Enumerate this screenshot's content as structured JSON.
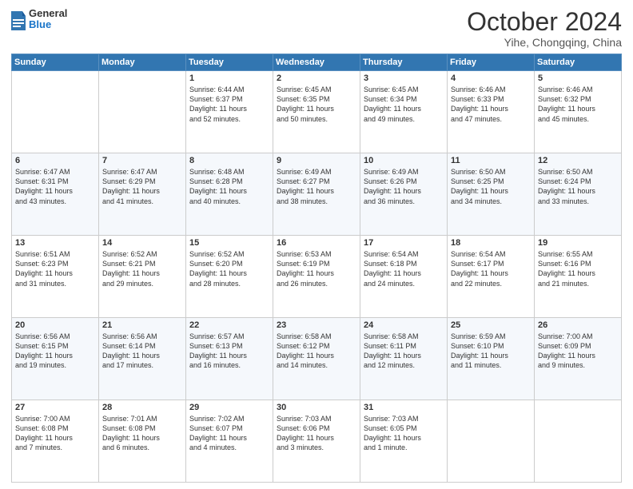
{
  "header": {
    "logo_general": "General",
    "logo_blue": "Blue",
    "month_title": "October 2024",
    "location": "Yihe, Chongqing, China"
  },
  "weekdays": [
    "Sunday",
    "Monday",
    "Tuesday",
    "Wednesday",
    "Thursday",
    "Friday",
    "Saturday"
  ],
  "rows": [
    [
      {
        "day": "",
        "text": ""
      },
      {
        "day": "",
        "text": ""
      },
      {
        "day": "1",
        "text": "Sunrise: 6:44 AM\nSunset: 6:37 PM\nDaylight: 11 hours\nand 52 minutes."
      },
      {
        "day": "2",
        "text": "Sunrise: 6:45 AM\nSunset: 6:35 PM\nDaylight: 11 hours\nand 50 minutes."
      },
      {
        "day": "3",
        "text": "Sunrise: 6:45 AM\nSunset: 6:34 PM\nDaylight: 11 hours\nand 49 minutes."
      },
      {
        "day": "4",
        "text": "Sunrise: 6:46 AM\nSunset: 6:33 PM\nDaylight: 11 hours\nand 47 minutes."
      },
      {
        "day": "5",
        "text": "Sunrise: 6:46 AM\nSunset: 6:32 PM\nDaylight: 11 hours\nand 45 minutes."
      }
    ],
    [
      {
        "day": "6",
        "text": "Sunrise: 6:47 AM\nSunset: 6:31 PM\nDaylight: 11 hours\nand 43 minutes."
      },
      {
        "day": "7",
        "text": "Sunrise: 6:47 AM\nSunset: 6:29 PM\nDaylight: 11 hours\nand 41 minutes."
      },
      {
        "day": "8",
        "text": "Sunrise: 6:48 AM\nSunset: 6:28 PM\nDaylight: 11 hours\nand 40 minutes."
      },
      {
        "day": "9",
        "text": "Sunrise: 6:49 AM\nSunset: 6:27 PM\nDaylight: 11 hours\nand 38 minutes."
      },
      {
        "day": "10",
        "text": "Sunrise: 6:49 AM\nSunset: 6:26 PM\nDaylight: 11 hours\nand 36 minutes."
      },
      {
        "day": "11",
        "text": "Sunrise: 6:50 AM\nSunset: 6:25 PM\nDaylight: 11 hours\nand 34 minutes."
      },
      {
        "day": "12",
        "text": "Sunrise: 6:50 AM\nSunset: 6:24 PM\nDaylight: 11 hours\nand 33 minutes."
      }
    ],
    [
      {
        "day": "13",
        "text": "Sunrise: 6:51 AM\nSunset: 6:23 PM\nDaylight: 11 hours\nand 31 minutes."
      },
      {
        "day": "14",
        "text": "Sunrise: 6:52 AM\nSunset: 6:21 PM\nDaylight: 11 hours\nand 29 minutes."
      },
      {
        "day": "15",
        "text": "Sunrise: 6:52 AM\nSunset: 6:20 PM\nDaylight: 11 hours\nand 28 minutes."
      },
      {
        "day": "16",
        "text": "Sunrise: 6:53 AM\nSunset: 6:19 PM\nDaylight: 11 hours\nand 26 minutes."
      },
      {
        "day": "17",
        "text": "Sunrise: 6:54 AM\nSunset: 6:18 PM\nDaylight: 11 hours\nand 24 minutes."
      },
      {
        "day": "18",
        "text": "Sunrise: 6:54 AM\nSunset: 6:17 PM\nDaylight: 11 hours\nand 22 minutes."
      },
      {
        "day": "19",
        "text": "Sunrise: 6:55 AM\nSunset: 6:16 PM\nDaylight: 11 hours\nand 21 minutes."
      }
    ],
    [
      {
        "day": "20",
        "text": "Sunrise: 6:56 AM\nSunset: 6:15 PM\nDaylight: 11 hours\nand 19 minutes."
      },
      {
        "day": "21",
        "text": "Sunrise: 6:56 AM\nSunset: 6:14 PM\nDaylight: 11 hours\nand 17 minutes."
      },
      {
        "day": "22",
        "text": "Sunrise: 6:57 AM\nSunset: 6:13 PM\nDaylight: 11 hours\nand 16 minutes."
      },
      {
        "day": "23",
        "text": "Sunrise: 6:58 AM\nSunset: 6:12 PM\nDaylight: 11 hours\nand 14 minutes."
      },
      {
        "day": "24",
        "text": "Sunrise: 6:58 AM\nSunset: 6:11 PM\nDaylight: 11 hours\nand 12 minutes."
      },
      {
        "day": "25",
        "text": "Sunrise: 6:59 AM\nSunset: 6:10 PM\nDaylight: 11 hours\nand 11 minutes."
      },
      {
        "day": "26",
        "text": "Sunrise: 7:00 AM\nSunset: 6:09 PM\nDaylight: 11 hours\nand 9 minutes."
      }
    ],
    [
      {
        "day": "27",
        "text": "Sunrise: 7:00 AM\nSunset: 6:08 PM\nDaylight: 11 hours\nand 7 minutes."
      },
      {
        "day": "28",
        "text": "Sunrise: 7:01 AM\nSunset: 6:08 PM\nDaylight: 11 hours\nand 6 minutes."
      },
      {
        "day": "29",
        "text": "Sunrise: 7:02 AM\nSunset: 6:07 PM\nDaylight: 11 hours\nand 4 minutes."
      },
      {
        "day": "30",
        "text": "Sunrise: 7:03 AM\nSunset: 6:06 PM\nDaylight: 11 hours\nand 3 minutes."
      },
      {
        "day": "31",
        "text": "Sunrise: 7:03 AM\nSunset: 6:05 PM\nDaylight: 11 hours\nand 1 minute."
      },
      {
        "day": "",
        "text": ""
      },
      {
        "day": "",
        "text": ""
      }
    ]
  ]
}
